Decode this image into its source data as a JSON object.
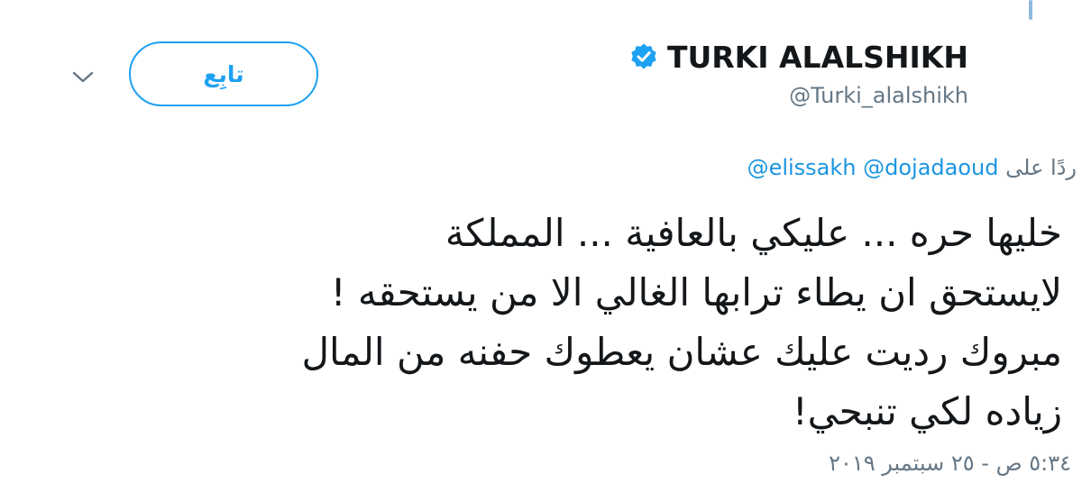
{
  "header": {
    "display_name": "TURKI ALALSHIKH",
    "handle": "@Turki_alalshikh",
    "verified": true,
    "follow_label": "تابِع"
  },
  "icons": {
    "verified": "verified-badge-icon",
    "more": "chevron-down-icon"
  },
  "reply": {
    "prefix": "ردًا على",
    "mentions": [
      "@dojadaoud",
      "@elissakh"
    ]
  },
  "tweet": {
    "lines": [
      "خليها حره ... عليكي بالعافية ... المملكة",
      "لايستحق ان يطاء ترابها الغالي الا من يستحقه !",
      "مبروك رديت عليك عشان يعطوك حفنه من المال",
      "زياده لكي تنبحي!"
    ]
  },
  "timestamp": "٥:٣٤ ص - ٢٥ سبتمبر ٢٠١٩",
  "colors": {
    "accent": "#1da1f2",
    "link": "#1b95e0",
    "text": "#14171a",
    "muted": "#657786"
  }
}
